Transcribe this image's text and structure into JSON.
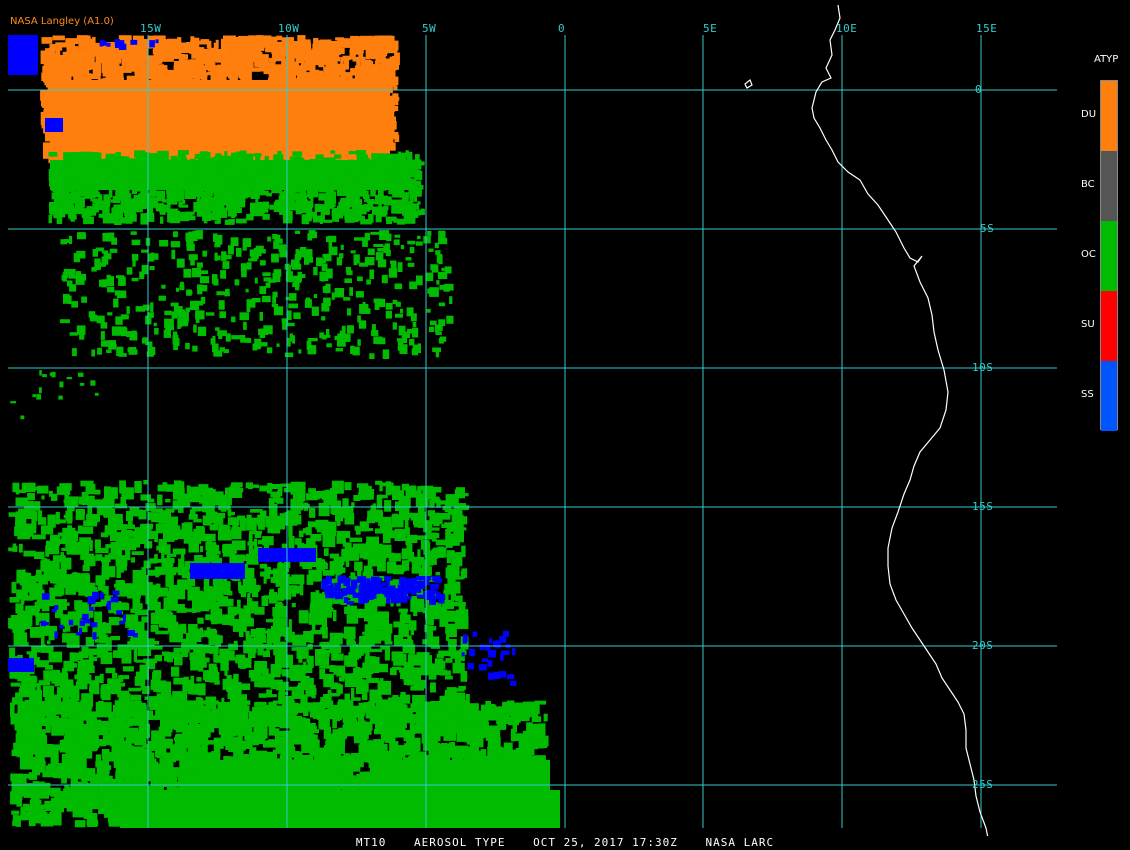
{
  "source": "NASA Langley (A1.0)",
  "lon_labels": [
    "15W",
    "10W",
    "5W",
    "0",
    "5E",
    "10E",
    "15E"
  ],
  "lat_labels": [
    "0",
    "5S",
    "10S",
    "15S",
    "20S",
    "25S"
  ],
  "legend": {
    "title": "ATYP",
    "items": [
      {
        "label": "DU",
        "color": "#ff7f0e"
      },
      {
        "label": "BC",
        "color": "#555555"
      },
      {
        "label": "OC",
        "color": "#00bb00"
      },
      {
        "label": "SU",
        "color": "#ff0000"
      },
      {
        "label": "SS",
        "color": "#0055ff"
      }
    ]
  },
  "colors": {
    "grid": "#33cccc",
    "coast": "#ffffff",
    "dust": "#ff7f0e",
    "organic_carbon": "#00bb00",
    "sea_salt": "#0000ff"
  },
  "footer": {
    "product": "MT10",
    "title": "AEROSOL TYPE",
    "datetime": "OCT 25, 2017 17:30Z",
    "credit": "NASA LARC"
  }
}
